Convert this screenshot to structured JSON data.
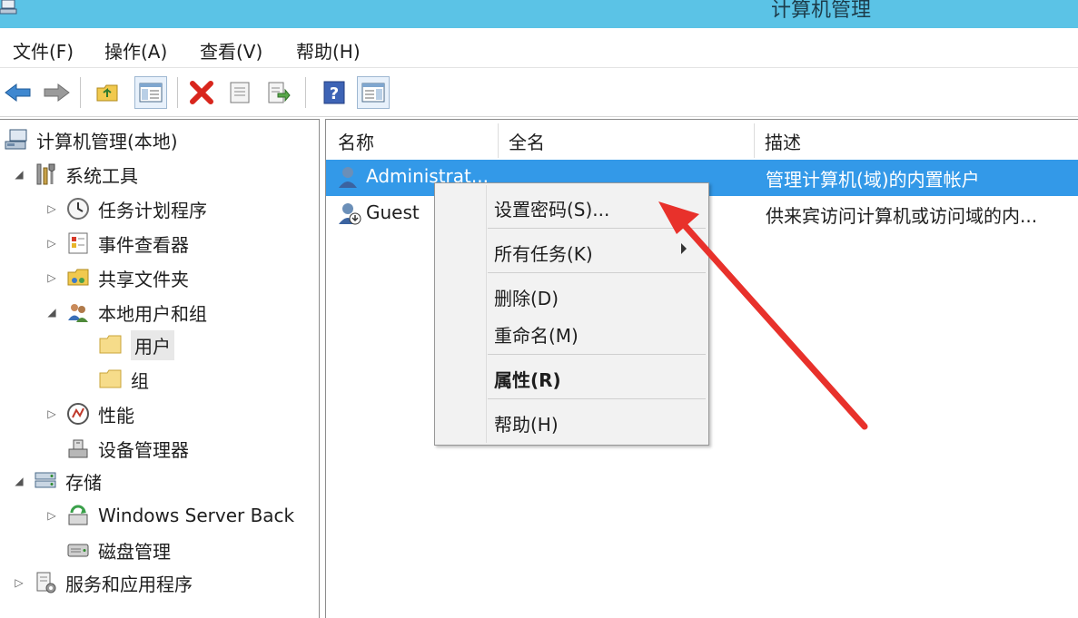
{
  "window": {
    "title": "计算机管理"
  },
  "menu": [
    {
      "label": "文件(F)"
    },
    {
      "label": "操作(A)"
    },
    {
      "label": "查看(V)"
    },
    {
      "label": "帮助(H)"
    }
  ],
  "tree": {
    "items": [
      {
        "label": "计算机管理(本地)",
        "icon": "computer-management-icon",
        "expander": ""
      },
      {
        "label": "系统工具",
        "icon": "system-tools-icon",
        "expander": "◢"
      },
      {
        "label": "任务计划程序",
        "icon": "clock-icon",
        "expander": "▷"
      },
      {
        "label": "事件查看器",
        "icon": "event-viewer-icon",
        "expander": "▷"
      },
      {
        "label": "共享文件夹",
        "icon": "shared-folder-icon",
        "expander": "▷"
      },
      {
        "label": "本地用户和组",
        "icon": "users-group-icon",
        "expander": "◢"
      },
      {
        "label": "用户",
        "icon": "folder-icon",
        "expander": ""
      },
      {
        "label": "组",
        "icon": "folder-icon",
        "expander": ""
      },
      {
        "label": "性能",
        "icon": "performance-icon",
        "expander": "▷"
      },
      {
        "label": "设备管理器",
        "icon": "device-manager-icon",
        "expander": ""
      },
      {
        "label": "存储",
        "icon": "storage-icon",
        "expander": "◢"
      },
      {
        "label": "Windows Server Back",
        "icon": "backup-icon",
        "expander": "▷"
      },
      {
        "label": "磁盘管理",
        "icon": "disk-management-icon",
        "expander": ""
      },
      {
        "label": "服务和应用程序",
        "icon": "services-icon",
        "expander": "▷"
      }
    ]
  },
  "list": {
    "columns": [
      {
        "label": "名称"
      },
      {
        "label": "全名"
      },
      {
        "label": "描述"
      }
    ],
    "rows": [
      {
        "name": "Administrat...",
        "fullname": "",
        "description": "管理计算机(域)的内置帐户",
        "selected": true
      },
      {
        "name": "Guest",
        "fullname": "",
        "description": "供来宾访问计算机或访问域的内...",
        "selected": false
      }
    ]
  },
  "context_menu": {
    "items": [
      {
        "label": "设置密码(S)..."
      },
      {
        "label": "所有任务(K)"
      },
      {
        "label": "删除(D)"
      },
      {
        "label": "重命名(M)"
      },
      {
        "label": "属性(R)"
      },
      {
        "label": "帮助(H)"
      }
    ]
  },
  "colors": {
    "titlebar": "#5bc3e6",
    "selection": "#3399e8",
    "annotation_arrow": "#e8312b"
  }
}
